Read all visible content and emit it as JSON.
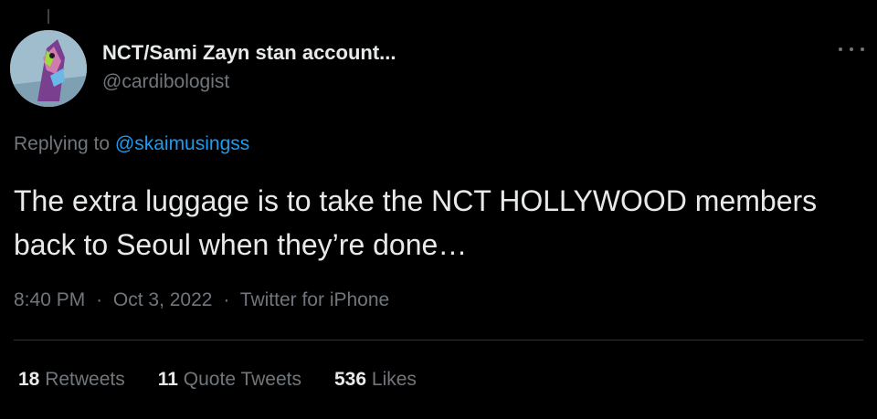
{
  "author": {
    "display_name": "NCT/Sami Zayn stan account...",
    "handle": "@cardibologist",
    "avatar_icon": "cartoon-character-avatar"
  },
  "reply": {
    "prefix": "Replying to",
    "mention": "@skaimusingss"
  },
  "tweet": {
    "text": "The extra luggage is to take the NCT HOLLYWOOD members back to Seoul when they’re done…"
  },
  "meta": {
    "time": "8:40 PM",
    "separator": "·",
    "date": "Oct 3, 2022",
    "source": "Twitter for iPhone"
  },
  "stats": [
    {
      "count": "18",
      "label": "Retweets"
    },
    {
      "count": "11",
      "label": "Quote Tweets"
    },
    {
      "count": "536",
      "label": "Likes"
    }
  ],
  "colors": {
    "background": "#000000",
    "primary_text": "#e7e9ea",
    "secondary_text": "#71767b",
    "link": "#1d9bf0",
    "divider": "#2f3336"
  },
  "icons": {
    "more": "more-horizontal-icon"
  }
}
